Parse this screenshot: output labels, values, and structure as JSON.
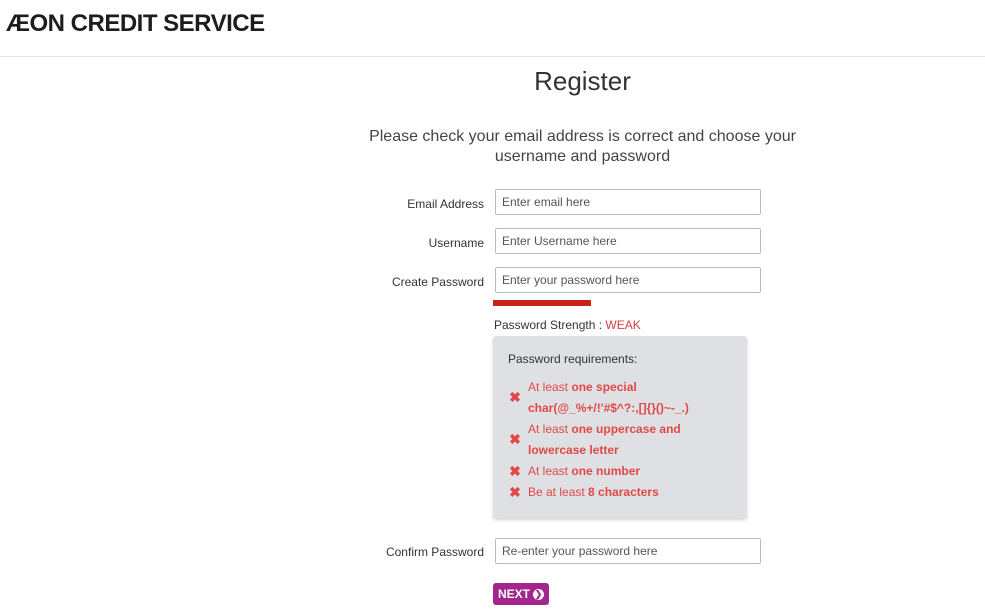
{
  "header": {
    "logo_text": "ÆON CREDIT SERVICE"
  },
  "page": {
    "title": "Register",
    "intro": "Please check your email address is correct and choose your username and password"
  },
  "form": {
    "email": {
      "label": "Email Address",
      "placeholder": "Enter email here",
      "value": ""
    },
    "username": {
      "label": "Username",
      "placeholder": "Enter Username here",
      "value": ""
    },
    "password": {
      "label": "Create Password",
      "placeholder": "Enter your password here",
      "value": ""
    },
    "confirm": {
      "label": "Confirm Password",
      "placeholder": "Re-enter your password here",
      "value": ""
    }
  },
  "strength": {
    "label": "Password Strength :",
    "value": "WEAK",
    "bar_color": "#c7231a",
    "level_fraction": 0.37
  },
  "requirements": {
    "title": "Password requirements:",
    "icon": "cross-icon",
    "status_color": "#e04848",
    "items": [
      {
        "prefix": "At least ",
        "bold": "one special char(@_%+/!'#$^?:,[]{}()~-_.)"
      },
      {
        "prefix": "At least ",
        "bold": "one uppercase and lowercase letter"
      },
      {
        "prefix": "At least ",
        "bold": "one number"
      },
      {
        "prefix": "Be at least ",
        "bold": "8 characters"
      }
    ]
  },
  "actions": {
    "next_label": "NEXT",
    "next_icon": "circle-arrow-right-icon",
    "accent": "#a3268c"
  }
}
